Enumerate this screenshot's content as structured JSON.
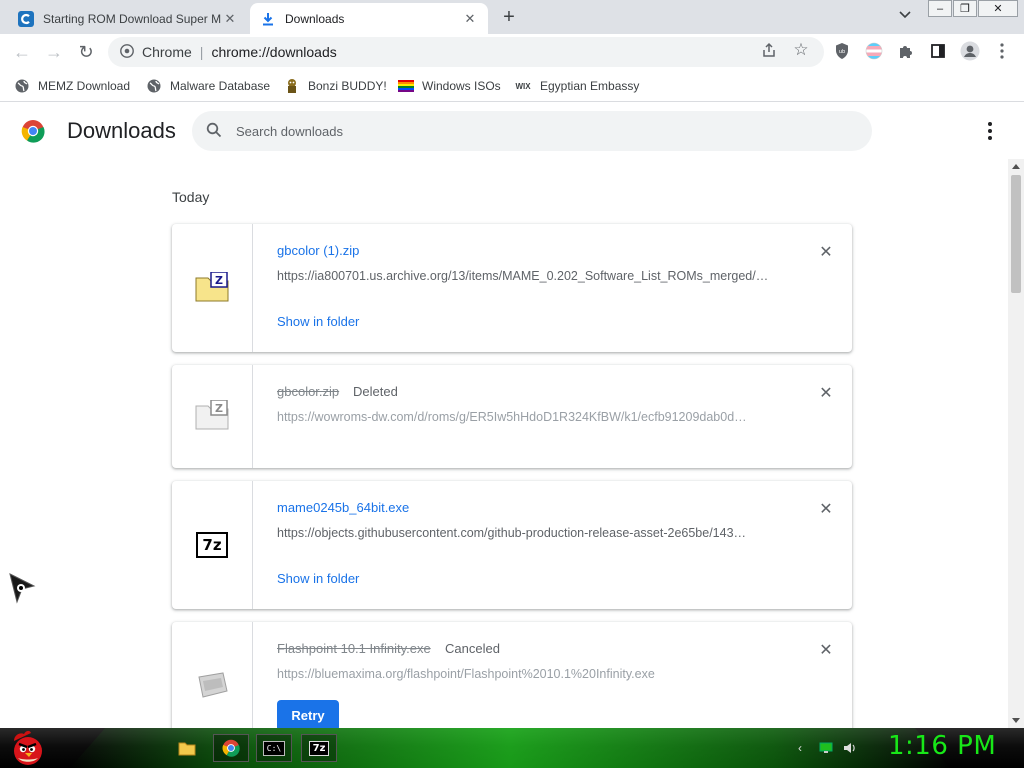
{
  "tabs": [
    {
      "title": "Starting ROM Download Super M",
      "active": false
    },
    {
      "title": "Downloads",
      "active": true
    }
  ],
  "omnibox": {
    "chip": "Chrome",
    "separator": "|",
    "url": "chrome://downloads"
  },
  "bookmarks": [
    {
      "label": "MEMZ Download"
    },
    {
      "label": "Malware Database"
    },
    {
      "label": "Bonzi BUDDY!"
    },
    {
      "label": "Windows ISOs"
    },
    {
      "label": "Egyptian Embassy",
      "icon_text": "WIX"
    }
  ],
  "page": {
    "title": "Downloads",
    "search_placeholder": "Search downloads",
    "day_label": "Today"
  },
  "downloads": [
    {
      "filename": "gbcolor (1).zip",
      "status": "",
      "url": "https://ia800701.us.archive.org/13/items/MAME_0.202_Software_List_ROMs_merged/…",
      "action": "Show in folder",
      "struck": false,
      "icon": "zip-file-icon"
    },
    {
      "filename": "gbcolor.zip",
      "status": "Deleted",
      "url": "https://wowroms-dw.com/d/roms/g/ER5Iw5hHdoD1R324KfBW/k1/ecfb91209dab0d…",
      "action": "",
      "struck": true,
      "icon": "zip-file-icon"
    },
    {
      "filename": "mame0245b_64bit.exe",
      "status": "",
      "url": "https://objects.githubusercontent.com/github-production-release-asset-2e65be/143…",
      "action": "Show in folder",
      "struck": false,
      "icon": "7z-icon",
      "icon_text": "7z"
    },
    {
      "filename": "Flashpoint 10.1 Infinity.exe",
      "status": "Canceled",
      "url": "https://bluemaxima.org/flashpoint/Flashpoint%2010.1%20Infinity.exe",
      "action": "Retry",
      "struck": true,
      "icon": "installer-icon"
    }
  ],
  "taskbar": {
    "clock": "1:16 PM",
    "cmd_icon_text": "C:\\",
    "sevenzip_icon_text": "7z"
  },
  "colors": {
    "accent": "#1a73e8",
    "tabstrip": "#dee1e6",
    "clock": "#18e818"
  }
}
